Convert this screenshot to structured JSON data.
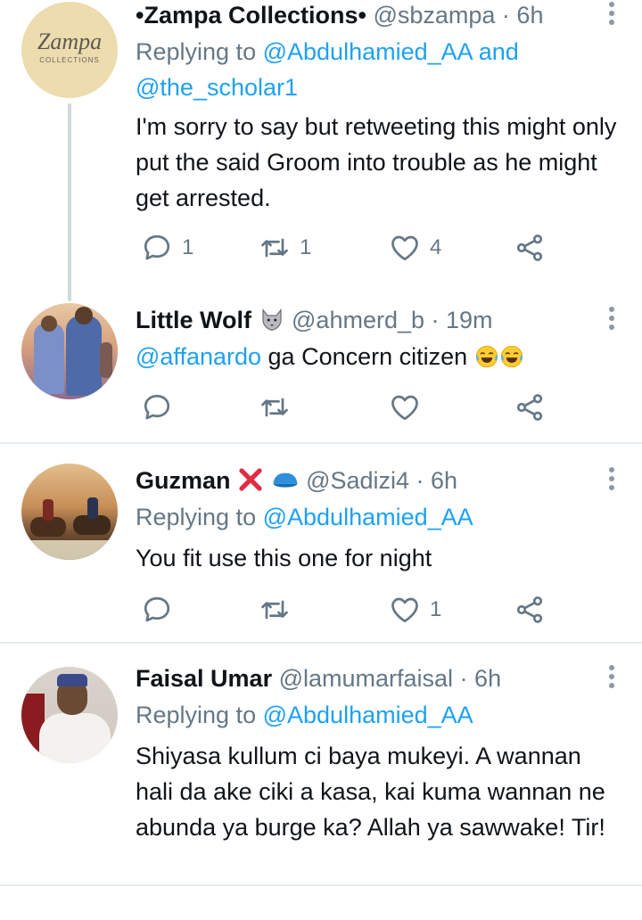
{
  "tweets": [
    {
      "name": "•Zampa Collections•",
      "handle": "@sbzampa · 6h",
      "avatar_text": "Zampa",
      "avatar_sub": "COLLECTIONS",
      "replying_prefix": "Replying to",
      "replying_users": [
        "@Abdulhamied_AA",
        "and",
        "@the_scholar1"
      ],
      "text": "I'm sorry to say but retweeting this might only put the said Groom into trouble as he might get arrested.",
      "reply_count": "1",
      "retweet_count": "1",
      "like_count": "4"
    },
    {
      "name": "Little Wolf",
      "handle": "@ahmerd_b · 19m",
      "mention": "@affanardo",
      "text": " ga Concern citizen",
      "reply_count": "",
      "retweet_count": "",
      "like_count": ""
    },
    {
      "name": "Guzman",
      "handle": "@Sadizi4 · 6h",
      "replying_prefix": "Replying to",
      "replying_user": "@Abdulhamied_AA",
      "text": "You fit use this one for night",
      "reply_count": "",
      "retweet_count": "",
      "like_count": "1"
    },
    {
      "name": "Faisal Umar",
      "handle": "@lamumarfaisal · 6h",
      "replying_prefix": "Replying to",
      "replying_user": "@Abdulhamied_AA",
      "text": "Shiyasa kullum ci baya mukeyi. A wannan hali da ake ciki a kasa, kai kuma wannan ne abunda ya burge ka? Allah ya sawwake! Tir!"
    }
  ],
  "colors": {
    "accent": "#1da1f2",
    "secondary_text": "#657786",
    "icon": "#657786",
    "divider": "#e6ecf0"
  }
}
